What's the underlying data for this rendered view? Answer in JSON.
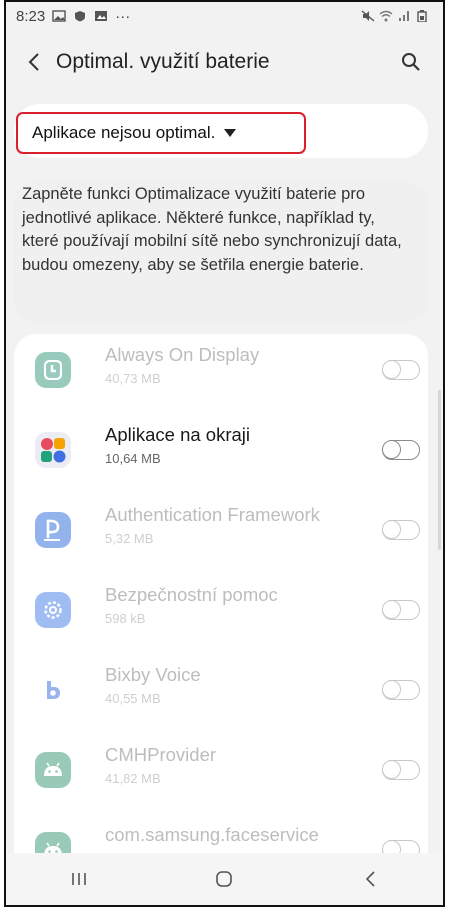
{
  "status_bar": {
    "time": "8:23",
    "more": "···"
  },
  "header": {
    "title": "Optimal. využití baterie"
  },
  "filter": {
    "label": "Aplikace nejsou optimal."
  },
  "description": "Zapněte funkci Optimalizace využití baterie pro jednotlivé aplikace. Některé funkce, například ty, které používají mobilní sítě nebo synchronizují data, budou omezeny, aby se šetřila energie baterie.",
  "apps": [
    {
      "name": "Always On Display",
      "size": "40,73 MB",
      "enabled": false,
      "icon": "clock-icon",
      "color": "#1e8e6e"
    },
    {
      "name": "Aplikace na okraji",
      "size": "10,64 MB",
      "enabled": true,
      "icon": "edge-apps-icon",
      "color": "#ececf4"
    },
    {
      "name": "Authentication Framework",
      "size": "5,32 MB",
      "enabled": false,
      "icon": "pass-icon",
      "color": "#1259d8"
    },
    {
      "name": "Bezpečnostní pomoc",
      "size": "598 kB",
      "enabled": false,
      "icon": "gear-icon",
      "color": "#2f6fe6"
    },
    {
      "name": "Bixby Voice",
      "size": "40,55 MB",
      "enabled": false,
      "icon": "bixby-icon",
      "color": "#1f5bd6"
    },
    {
      "name": "CMHProvider",
      "size": "41,82 MB",
      "enabled": false,
      "icon": "android-icon",
      "color": "#1f8a62"
    },
    {
      "name": "com.samsung.faceservice",
      "size": "",
      "enabled": false,
      "icon": "android-icon",
      "color": "#1f8a62"
    }
  ],
  "colors": {
    "highlight": "#d9202c",
    "bg": "#f2f2f2"
  }
}
